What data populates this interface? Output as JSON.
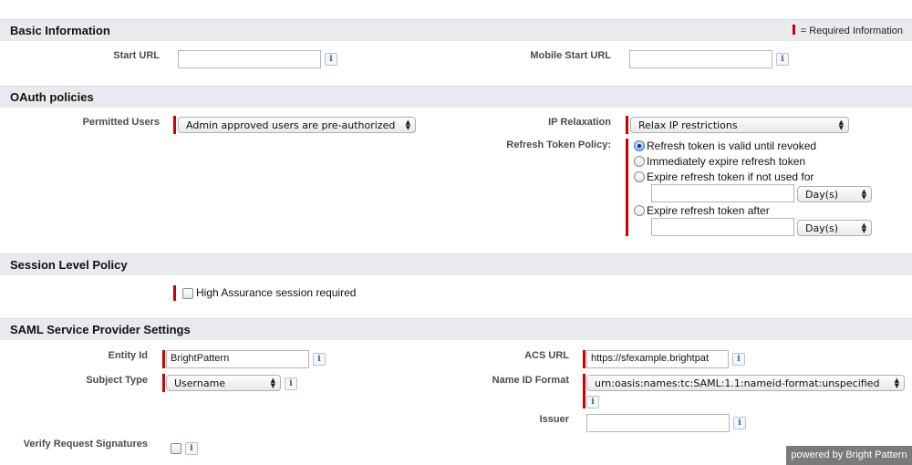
{
  "required_legend": "= Required Information",
  "basic": {
    "title": "Basic Information",
    "start_url_label": "Start URL",
    "start_url_value": "",
    "mobile_start_url_label": "Mobile Start URL",
    "mobile_start_url_value": ""
  },
  "oauth": {
    "title": "OAuth policies",
    "permitted_users_label": "Permitted Users",
    "permitted_users_value": "Admin approved users are pre-authorized",
    "ip_relaxation_label": "IP Relaxation",
    "ip_relaxation_value": "Relax IP restrictions",
    "refresh_policy_label": "Refresh Token Policy:",
    "refresh_options": [
      "Refresh token is valid until revoked",
      "Immediately expire refresh token",
      "Expire refresh token if not used for",
      "Expire refresh token after"
    ],
    "refresh_selected_index": 0,
    "unused_for_value": "",
    "unused_for_unit": "Day(s)",
    "expire_after_value": "",
    "expire_after_unit": "Day(s)"
  },
  "session": {
    "title": "Session Level Policy",
    "high_assurance_label": "High Assurance session required",
    "high_assurance_checked": false
  },
  "saml": {
    "title": "SAML Service Provider Settings",
    "entity_id_label": "Entity Id",
    "entity_id_value": "BrightPattern",
    "acs_url_label": "ACS URL",
    "acs_url_value": "https://sfexample.brightpat",
    "subject_type_label": "Subject Type",
    "subject_type_value": "Username",
    "name_id_format_label": "Name ID Format",
    "name_id_format_value": "urn:oasis:names:tc:SAML:1.1:nameid-format:unspecified",
    "issuer_label": "Issuer",
    "issuer_value": "",
    "verify_signatures_label": "Verify Request Signatures",
    "verify_signatures_checked": false
  },
  "info_glyph": "i",
  "footer": "powered by Bright Pattern"
}
